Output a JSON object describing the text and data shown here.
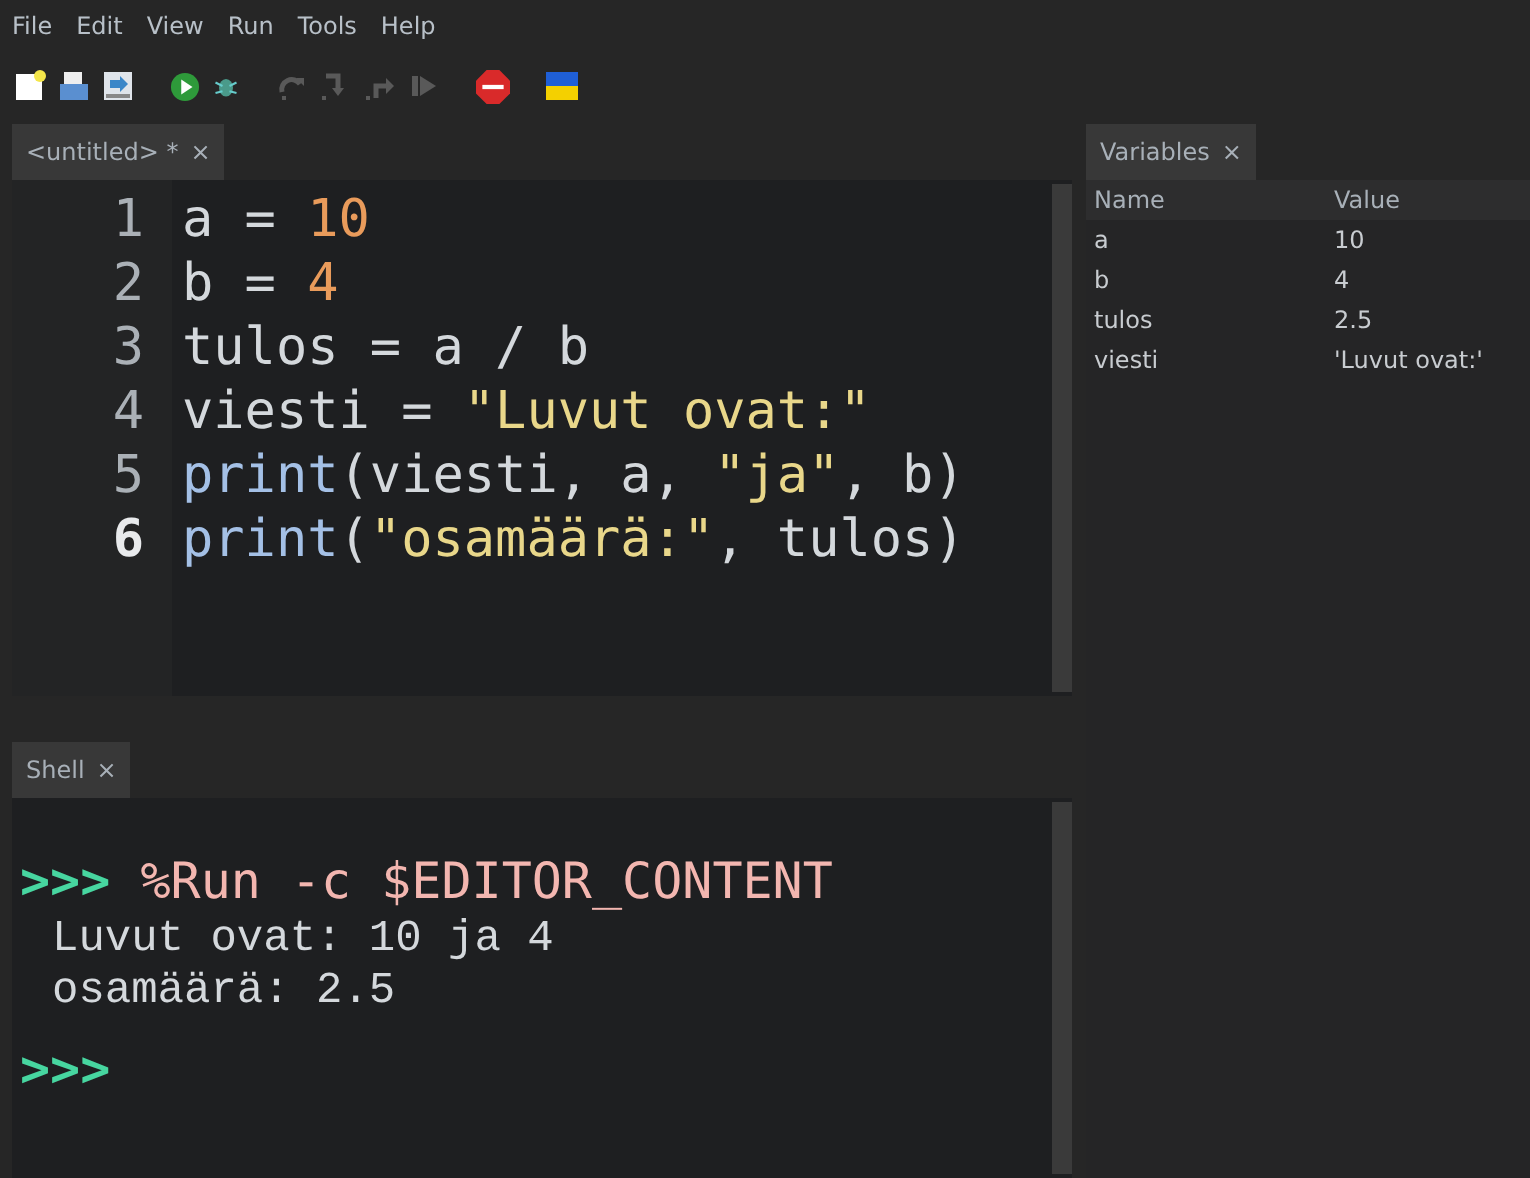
{
  "menu": [
    "File",
    "Edit",
    "View",
    "Run",
    "Tools",
    "Help"
  ],
  "toolbar": [
    {
      "kind": "new",
      "disabled": false
    },
    {
      "kind": "open",
      "disabled": false
    },
    {
      "kind": "save",
      "disabled": false
    },
    {
      "kind": "run",
      "disabled": false
    },
    {
      "kind": "debug",
      "disabled": false
    },
    {
      "kind": "step-over",
      "disabled": true
    },
    {
      "kind": "step-into",
      "disabled": true
    },
    {
      "kind": "step-out",
      "disabled": true
    },
    {
      "kind": "resume",
      "disabled": true
    },
    {
      "kind": "stop",
      "disabled": false
    },
    {
      "kind": "flag",
      "disabled": false
    }
  ],
  "editor": {
    "tab": {
      "label": "<untitled> *",
      "close": "×"
    },
    "lines": [
      {
        "number": "1",
        "current": false,
        "tokens": [
          {
            "kind": "name",
            "text": "a = "
          },
          {
            "kind": "number",
            "text": "10"
          }
        ]
      },
      {
        "number": "2",
        "current": false,
        "tokens": [
          {
            "kind": "name",
            "text": "b = "
          },
          {
            "kind": "number",
            "text": "4"
          }
        ]
      },
      {
        "number": "3",
        "current": false,
        "tokens": [
          {
            "kind": "name",
            "text": "tulos = a / b"
          }
        ]
      },
      {
        "number": "4",
        "current": false,
        "tokens": [
          {
            "kind": "name",
            "text": "viesti = "
          },
          {
            "kind": "string",
            "text": "\"Luvut ovat:\""
          }
        ]
      },
      {
        "number": "5",
        "current": false,
        "tokens": [
          {
            "kind": "builtin",
            "text": "print"
          },
          {
            "kind": "name",
            "text": "(viesti, a, "
          },
          {
            "kind": "string",
            "text": "\"ja\""
          },
          {
            "kind": "name",
            "text": ", b)"
          }
        ]
      },
      {
        "number": "6",
        "current": true,
        "tokens": [
          {
            "kind": "builtin",
            "text": "print"
          },
          {
            "kind": "name",
            "text": "("
          },
          {
            "kind": "string",
            "text": "\"osamäärä:\""
          },
          {
            "kind": "name",
            "text": ", tulos)"
          }
        ]
      }
    ]
  },
  "shell": {
    "tab": {
      "label": "Shell",
      "close": "×"
    },
    "lines": [
      {
        "kind": "command",
        "prompt": ">>>",
        "text": "%Run -c $EDITOR_CONTENT"
      },
      {
        "kind": "output",
        "text": "Luvut ovat: 10 ja 4"
      },
      {
        "kind": "output",
        "text": "osamäärä: 2.5"
      },
      {
        "kind": "prompt",
        "prompt": ">>>"
      }
    ]
  },
  "variables": {
    "tab": {
      "label": "Variables",
      "close": "×"
    },
    "columns": [
      "Name",
      "Value"
    ],
    "rows": [
      [
        "a",
        "10"
      ],
      [
        "b",
        "4"
      ],
      [
        "tulos",
        "2.5"
      ],
      [
        "viesti",
        "'Luvut ovat:'"
      ]
    ]
  }
}
